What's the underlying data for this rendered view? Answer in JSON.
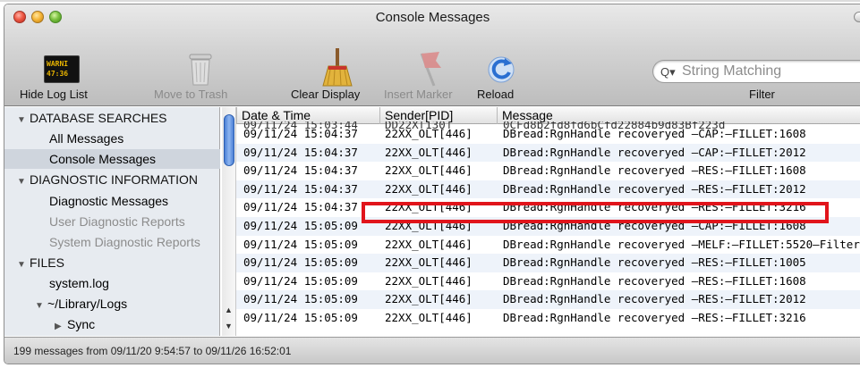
{
  "window": {
    "title": "Console Messages"
  },
  "toolbar": {
    "warn_icon_text": [
      "WARNI",
      "47:36"
    ],
    "hide_log_list": "Hide Log List",
    "move_to_trash": "Move to Trash",
    "clear_display": "Clear Display",
    "insert_marker": "Insert Marker",
    "reload": "Reload",
    "filter": "Filter",
    "search_placeholder": "String Matching"
  },
  "sidebar": {
    "database_searches": "DATABASE SEARCHES",
    "all_messages": "All Messages",
    "console_messages": "Console Messages",
    "diagnostic_information": "DIAGNOSTIC INFORMATION",
    "diagnostic_messages": "Diagnostic Messages",
    "user_diagnostic_reports": "User Diagnostic Reports",
    "system_diagnostic_reports": "System Diagnostic Reports",
    "files": "FILES",
    "system_log": "system.log",
    "library_logs": "~/Library/Logs",
    "sync": "Sync"
  },
  "table": {
    "columns": [
      "Date & Time",
      "Sender[PID]",
      "Message"
    ],
    "partial_row": {
      "date": "09/11/24 15:03:44",
      "sender": "DD22X[130]",
      "message": "0CFd8b2fd8fd6bCfd22884b9d83Bf223d"
    },
    "rows": [
      {
        "date": "09/11/24 15:04:37",
        "sender": "22XX_OLT[446]",
        "message": "DBread:RgnHandle recoveryed –CAP:–FILLET:1608"
      },
      {
        "date": "09/11/24 15:04:37",
        "sender": "22XX_OLT[446]",
        "message": "DBread:RgnHandle recoveryed –CAP:–FILLET:2012"
      },
      {
        "date": "09/11/24 15:04:37",
        "sender": "22XX_OLT[446]",
        "message": "DBread:RgnHandle recoveryed –RES:–FILLET:1608"
      },
      {
        "date": "09/11/24 15:04:37",
        "sender": "22XX_OLT[446]",
        "message": "DBread:RgnHandle recoveryed –RES:–FILLET:2012"
      },
      {
        "date": "09/11/24 15:04:37",
        "sender": "22XX_OLT[446]",
        "message": "DBread:RgnHandle recoveryed –RES:–FILLET:3216"
      },
      {
        "date": "09/11/24 15:05:09",
        "sender": "22XX_OLT[446]",
        "message": "DBread:RgnHandle recoveryed –CAP:–FILLET:1608"
      },
      {
        "date": "09/11/24 15:05:09",
        "sender": "22XX_OLT[446]",
        "message": "DBread:RgnHandle recoveryed –MELF:–FILLET:5520–Filter"
      },
      {
        "date": "09/11/24 15:05:09",
        "sender": "22XX_OLT[446]",
        "message": "DBread:RgnHandle recoveryed –RES:–FILLET:1005"
      },
      {
        "date": "09/11/24 15:05:09",
        "sender": "22XX_OLT[446]",
        "message": "DBread:RgnHandle recoveryed –RES:–FILLET:1608"
      },
      {
        "date": "09/11/24 15:05:09",
        "sender": "22XX_OLT[446]",
        "message": "DBread:RgnHandle recoveryed –RES:–FILLET:2012"
      },
      {
        "date": "09/11/24 15:05:09",
        "sender": "22XX_OLT[446]",
        "message": "DBread:RgnHandle recoveryed –RES:–FILLET:3216"
      }
    ]
  },
  "status": {
    "text": "199 messages from 09/11/20 9:54:57 to 09/11/26 16:52:01"
  },
  "colors": {
    "highlight": "#e1141b",
    "sidebar_bg": "#e7ebf0",
    "row_alt": "#eef3fa"
  }
}
